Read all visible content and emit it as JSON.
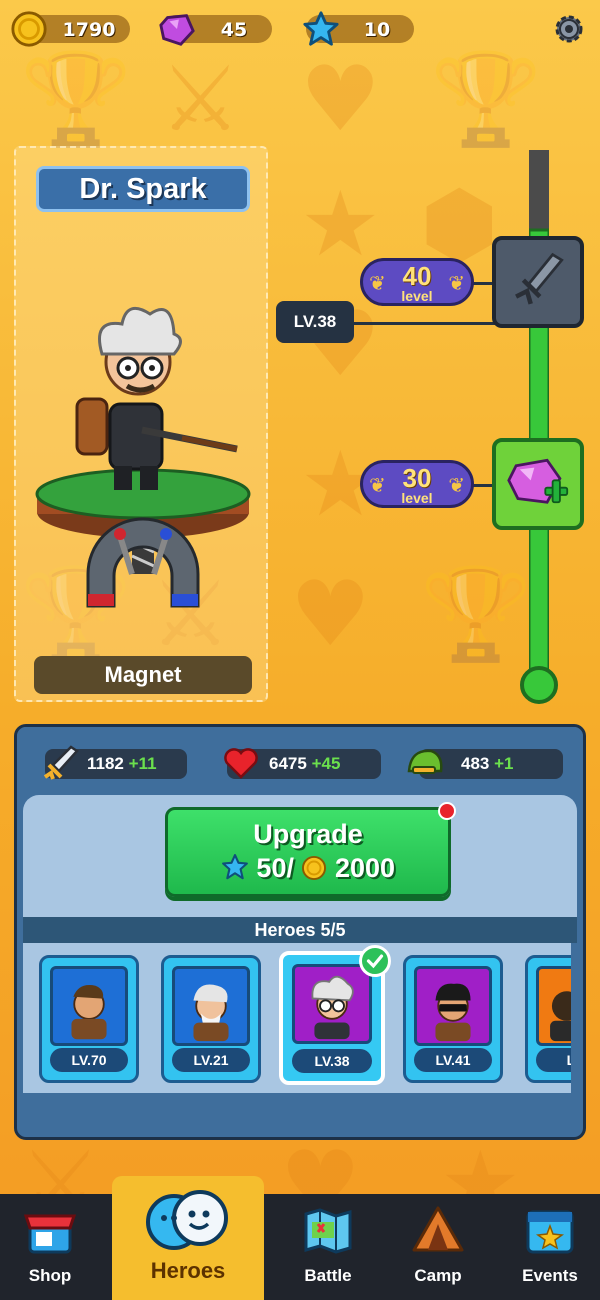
{
  "currencies": {
    "coins": "1790",
    "gems": "45",
    "stars": "10"
  },
  "hero": {
    "name": "Dr. Spark",
    "weapon": "Magnet",
    "current_level": "LV.38"
  },
  "level_track": [
    {
      "level": "40",
      "label": "level",
      "reward": "sword-icon",
      "state": "locked"
    },
    {
      "level": "30",
      "label": "level",
      "reward": "gem-plus-icon",
      "state": "unlocked"
    }
  ],
  "stats": [
    {
      "name": "attack",
      "icon": "sword-icon",
      "value": "1182",
      "bonus": "+11"
    },
    {
      "name": "health",
      "icon": "heart-icon",
      "value": "6475",
      "bonus": "+45"
    },
    {
      "name": "armor",
      "icon": "helmet-icon",
      "value": "483",
      "bonus": "+1"
    }
  ],
  "upgrade": {
    "title": "Upgrade",
    "stars_cost": "50/",
    "coin_cost": "2000"
  },
  "heroes_header": "Heroes 5/5",
  "heroes": [
    {
      "level": "LV.70",
      "color": "#1e6fd6",
      "selected": false
    },
    {
      "level": "LV.21",
      "color": "#1e6fd6",
      "selected": false
    },
    {
      "level": "LV.38",
      "color": "#a01fc7",
      "selected": true
    },
    {
      "level": "LV.41",
      "color": "#a01fc7",
      "selected": false
    },
    {
      "level": "LV",
      "color": "#f07a12",
      "selected": false
    }
  ],
  "nav": {
    "shop": "Shop",
    "heroes": "Heroes",
    "battle": "Battle",
    "camp": "Camp",
    "events": "Events"
  },
  "colors": {
    "background": "#f6ad2a",
    "panel": "#3f6e9c",
    "accent_green": "#1fb94c",
    "nav_active": "#f5be2e"
  }
}
